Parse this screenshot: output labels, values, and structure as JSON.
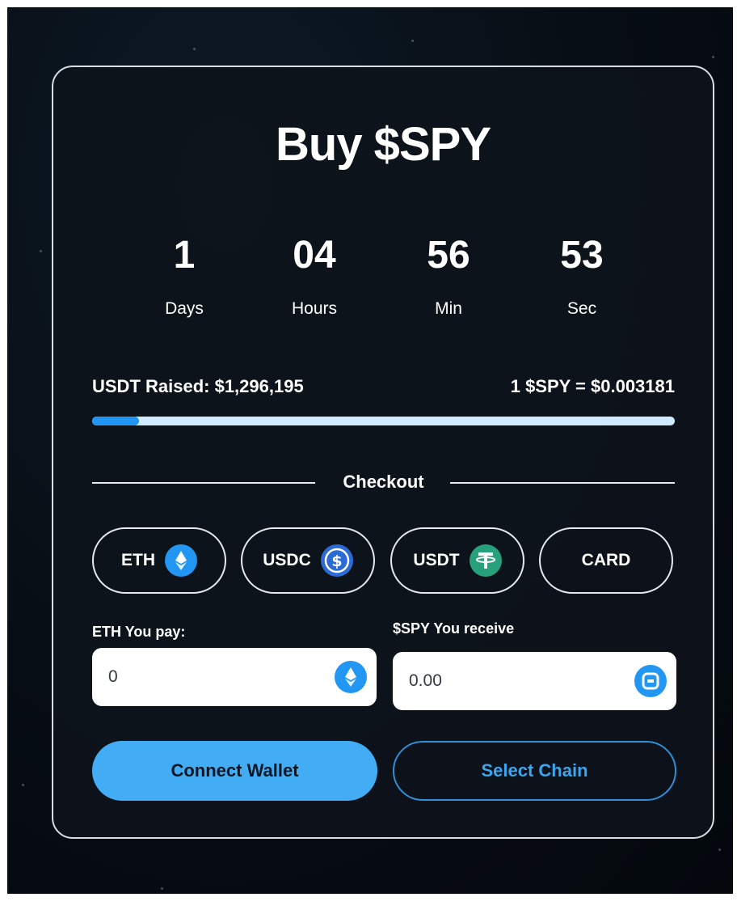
{
  "title": "Buy $SPY",
  "countdown": [
    {
      "value": "1",
      "label": "Days"
    },
    {
      "value": "04",
      "label": "Hours"
    },
    {
      "value": "56",
      "label": "Min"
    },
    {
      "value": "53",
      "label": "Sec"
    }
  ],
  "stats": {
    "raised": "USDT Raised: $1,296,195",
    "price": "1 $SPY = $0.003181",
    "progress_percent": 8
  },
  "checkout_label": "Checkout",
  "payment_options": [
    {
      "label": "ETH",
      "icon": "eth-icon",
      "color": "#2196f3"
    },
    {
      "label": "USDC",
      "icon": "usdc-icon",
      "color": "#2b6bd6"
    },
    {
      "label": "USDT",
      "icon": "usdt-icon",
      "color": "#27a17b"
    },
    {
      "label": "CARD",
      "icon": "",
      "color": ""
    }
  ],
  "pay_field": {
    "label": "ETH You pay:",
    "value": "0",
    "icon": "eth-icon"
  },
  "receive_field": {
    "label": "$SPY You receive",
    "value": "0.00",
    "icon": "spy-token-icon"
  },
  "buttons": {
    "connect": "Connect Wallet",
    "select_chain": "Select Chain"
  },
  "colors": {
    "accent": "#42adf5",
    "progress_track": "#cfe9ff",
    "progress_fill": "#2196f3"
  }
}
